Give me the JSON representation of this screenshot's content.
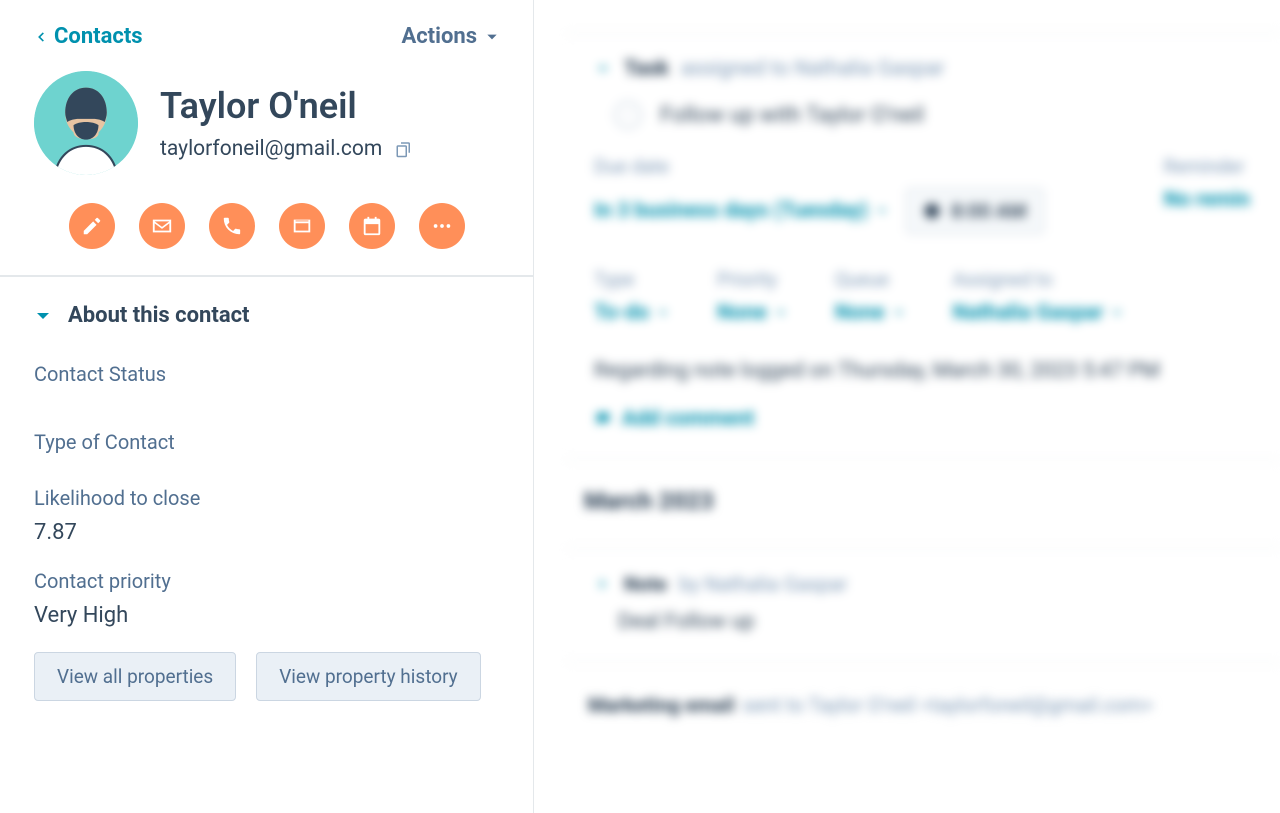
{
  "nav": {
    "back_label": "Contacts",
    "actions_label": "Actions"
  },
  "contact": {
    "name": "Taylor O'neil",
    "email": "taylorfoneil@gmail.com"
  },
  "about": {
    "section_title": "About this contact",
    "props": {
      "status_label": "Contact Status",
      "type_label": "Type of Contact",
      "likelihood_label": "Likelihood to close",
      "likelihood_value": "7.87",
      "priority_label": "Contact priority",
      "priority_value": "Very High"
    },
    "view_all_btn": "View all properties",
    "view_history_btn": "View property history"
  },
  "timeline": {
    "task": {
      "entity": "Task",
      "assigned_text": "assigned to Nathalia Gaspar",
      "title": "Follow up with Taylor O'neil",
      "due_date_label": "Due date",
      "due_date_value": "In 3 business days (Tuesday)",
      "time_value": "8:00 AM",
      "reminder_label": "Reminder",
      "reminder_value": "No remin",
      "type_label": "Type",
      "type_value": "To-do",
      "priority_label": "Priority",
      "priority_value": "None",
      "queue_label": "Queue",
      "queue_value": "None",
      "assigned_to_label": "Assigned to",
      "assigned_to_value": "Nathalia Gaspar",
      "regarding": "Regarding note logged on Thursday, March 30, 2023 5:47 PM",
      "add_comment": "Add comment"
    },
    "month_header": "March 2023",
    "note": {
      "entity": "Note",
      "by_text": "by Nathalia Gaspar",
      "body": "Deal Follow up"
    },
    "marketing_email": {
      "entity": "Marketing email",
      "sent_text": "sent to Taylor O'neil <taylorfoneil@gmail.com>"
    }
  }
}
